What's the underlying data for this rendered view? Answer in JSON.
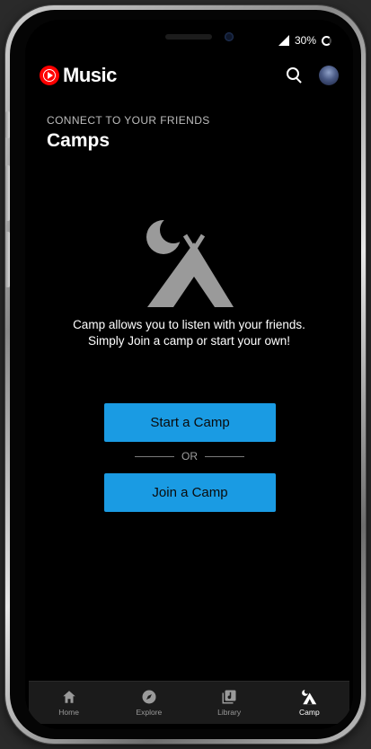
{
  "status_bar": {
    "battery": "30%"
  },
  "app": {
    "brand": "Music"
  },
  "header": {
    "subtitle": "CONNECT TO YOUR FRIENDS",
    "title": "Camps"
  },
  "empty_state": {
    "line1": "Camp allows you to listen with your friends.",
    "line2": "Simply Join a camp or start your own!"
  },
  "actions": {
    "start_label": "Start a Camp",
    "or_label": "OR",
    "join_label": "Join a Camp"
  },
  "bottom_nav": {
    "items": [
      {
        "label": "Home",
        "icon": "home-icon"
      },
      {
        "label": "Explore",
        "icon": "compass-icon"
      },
      {
        "label": "Library",
        "icon": "library-icon"
      },
      {
        "label": "Camp",
        "icon": "tent-icon",
        "active": true
      }
    ]
  },
  "colors": {
    "accent": "#1a9be3",
    "brand_red": "#ff0000",
    "illustration": "#9a9a9a",
    "background": "#000000"
  }
}
